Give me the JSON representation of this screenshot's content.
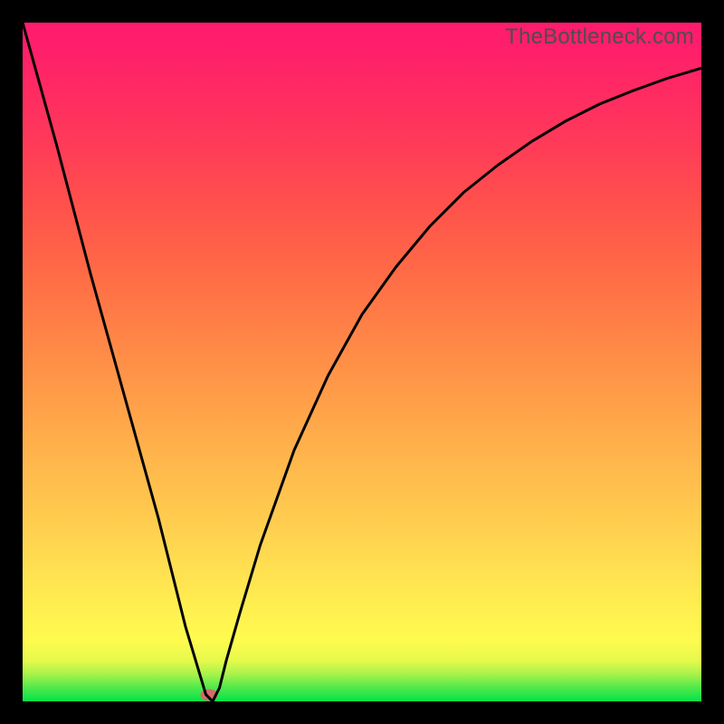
{
  "watermark": "TheBottleneck.com",
  "marker": {
    "x_pct": 27.5,
    "y_pct": 99.0
  },
  "chart_data": {
    "type": "line",
    "title": "",
    "xlabel": "",
    "ylabel": "",
    "xlim": [
      0,
      100
    ],
    "ylim": [
      0,
      100
    ],
    "grid": false,
    "series": [
      {
        "name": "bottleneck-curve",
        "x": [
          0,
          5,
          10,
          15,
          20,
          24,
          27,
          28,
          29,
          30,
          32,
          35,
          40,
          45,
          50,
          55,
          60,
          65,
          70,
          75,
          80,
          85,
          90,
          95,
          100
        ],
        "y": [
          100,
          82,
          63,
          45,
          27,
          11,
          1,
          0,
          2,
          6,
          13,
          23,
          37,
          48,
          57,
          64,
          70,
          75,
          79,
          82.5,
          85.5,
          88,
          90,
          91.8,
          93.3
        ]
      }
    ],
    "background_gradient": {
      "type": "vertical",
      "stops": [
        {
          "pos": 0.0,
          "color": "#05e24a"
        },
        {
          "pos": 0.05,
          "color": "#a8f24b"
        },
        {
          "pos": 0.1,
          "color": "#fffb4f"
        },
        {
          "pos": 0.3,
          "color": "#ffc44e"
        },
        {
          "pos": 0.55,
          "color": "#ff8446"
        },
        {
          "pos": 0.8,
          "color": "#ff4a52"
        },
        {
          "pos": 1.0,
          "color": "#ff1b6e"
        }
      ]
    },
    "annotations": [
      {
        "type": "marker",
        "x": 27.5,
        "y": 1.0,
        "color": "#d66a6a"
      }
    ]
  }
}
